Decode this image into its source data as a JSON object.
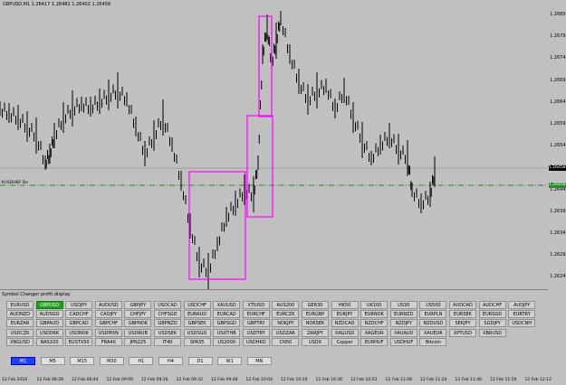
{
  "chart": {
    "title": "GBPUSD,M1  1.26417 1.26482 1.26402 1.26458",
    "hline_label": "#USDHBF Ba",
    "current_price": "1.26458",
    "green_price": "1.26458",
    "price_axis": [
      "1.26850",
      "1.26795",
      "1.26745",
      "1.26695",
      "1.26645",
      "1.26595",
      "1.26545",
      "1.26495",
      "1.26445",
      "1.26395",
      "1.26345",
      "1.26295",
      "1.26245"
    ],
    "time_axis": [
      "12 Feb 2018",
      "12 Feb 08:28",
      "12 Feb 08:44",
      "12 Feb 09:00",
      "12 Feb 09:16",
      "12 Feb 09:32",
      "12 Feb 09:48",
      "12 Feb 10:04",
      "12 Feb 10:20",
      "12 Feb 10:36",
      "12 Feb 10:52",
      "12 Feb 11:08",
      "12 Feb 11:24",
      "12 Feb 11:40",
      "12 Feb 11:56",
      "12 Feb 12:12"
    ]
  },
  "panel": {
    "title": "Symbol Changer profit display",
    "rows": [
      [
        "EURUSD",
        "GBPUSD",
        "USDJPY",
        "AUDUSD",
        "GBPJPY",
        "USDCAD",
        "USDCHF",
        "XAUUSD",
        "XTIUSD",
        "AUS200",
        "GER30",
        "HK50",
        "UK100",
        "US30",
        "US500",
        "AUDCAD",
        "AUDCHF",
        "AUDJPY"
      ],
      [
        "AUDNZD",
        "AUDSGD",
        "CADCHF",
        "CADJPY",
        "CHFJPY",
        "CHFSGD",
        "EURAUD",
        "EURCAD",
        "EURCHF",
        "EURCZK",
        "EURGBP",
        "EURJPY",
        "EURNOK",
        "EURNZD",
        "EURPLN",
        "EURSEK",
        "EURSGD",
        "EURTRY"
      ],
      [
        "EURZAR",
        "GBPAUD",
        "GBPCAD",
        "GBPCHF",
        "GBPNOK",
        "GBPNZD",
        "GBPSEK",
        "GBPSGD",
        "GBPTRY",
        "NOKJPY",
        "NOKSEK",
        "NZDCAD",
        "NZDCHF",
        "NZDJPY",
        "NZDUSD",
        "SEKJPY",
        "SGDJPY",
        "USDCNH"
      ],
      [
        "USDCZK",
        "USDDKK",
        "USDNOK",
        "USDMXN",
        "USDRUB",
        "USDSEK",
        "USDSGD",
        "USDTHB",
        "USDTRY",
        "USDZAR",
        "ZARJPY",
        "XAGUSD",
        "XAGEUR",
        "XAUAUD",
        "XAUEUR",
        "XPTUSD",
        "XBRUSD",
        ""
      ],
      [
        "XNGUSD",
        "NAS100",
        "EUSTX50",
        "FRA40",
        "JPN225",
        "IT40",
        "SPA35",
        "US2000",
        "USDHKD",
        "CN50",
        "USDX",
        "Copper",
        "EURHUF",
        "USDHUF",
        "Bitcoin",
        "",
        "",
        ""
      ]
    ],
    "active_symbol": "GBPUSD",
    "timeframes": [
      "M1",
      "M5",
      "M15",
      "M30",
      "H1",
      "H4",
      "D1",
      "W1",
      "MN"
    ],
    "active_timeframe": "M1"
  },
  "colors": {
    "active_symbol_bg": "#20a020",
    "active_tf_bg": "#2040ff",
    "highlight_box": "#ff00ff",
    "green_line": "#2a8a2a"
  }
}
